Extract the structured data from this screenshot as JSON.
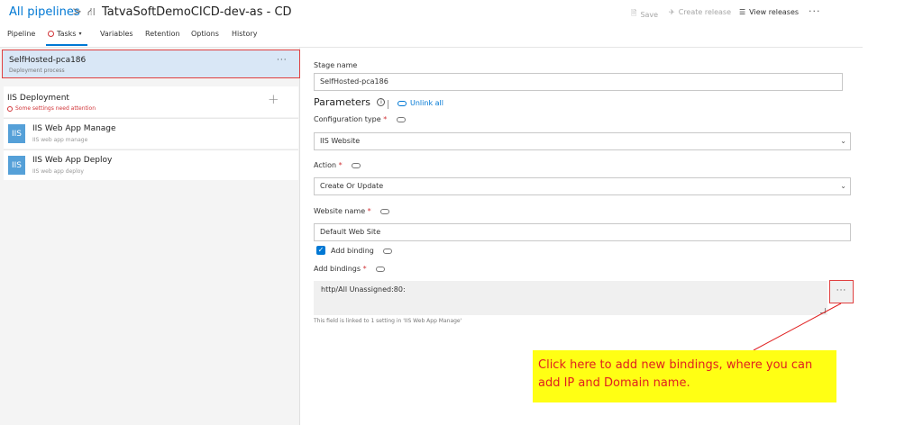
{
  "header": {
    "breadcrumb": "All pipelines",
    "separator": ">",
    "pipeline_title": "TatvaSoftDemoCICD-dev-as - CD",
    "save": "Save",
    "create_release": "Create release",
    "view_releases": "View releases",
    "more": "···"
  },
  "tabs": [
    {
      "label": "Pipeline"
    },
    {
      "label": "Tasks"
    },
    {
      "label": "Variables"
    },
    {
      "label": "Retention"
    },
    {
      "label": "Options"
    },
    {
      "label": "History"
    }
  ],
  "left": {
    "stage": {
      "title": "SelfHosted-pca186",
      "subtitle": "Deployment process",
      "more": "···"
    },
    "job": {
      "title": "IIS Deployment",
      "warning": "Some settings need attention",
      "add": "+"
    },
    "tasks": [
      {
        "icon": "IIS",
        "title": "IIS Web App Manage",
        "subtitle": "IIS web app manage"
      },
      {
        "icon": "IIS",
        "title": "IIS Web App Deploy",
        "subtitle": "IIS web app deploy"
      }
    ]
  },
  "form": {
    "stage_name_label": "Stage name",
    "stage_name_value": "SelfHosted-pca186",
    "parameters": "Parameters",
    "unlink_all": "Unlink all",
    "config_type_label": "Configuration type",
    "config_type_value": "IIS Website",
    "action_label": "Action",
    "action_value": "Create Or Update",
    "website_name_label": "Website name",
    "website_name_value": "Default Web Site",
    "add_binding_label": "Add binding",
    "add_bindings_label": "Add bindings",
    "bindings_value": "http/All Unassigned:80:",
    "ellipsis": "···",
    "hint": "This field is linked to 1 setting in 'IIS Web App Manage'",
    "required_mark": "*"
  },
  "callout": {
    "line1": "Click here to add new bindings, where you can",
    "line2": "add IP and Domain name."
  },
  "colors": {
    "accent": "#0078d4",
    "error": "#d13438",
    "callout_bg": "#ffff14",
    "callout_text": "#e02020"
  }
}
